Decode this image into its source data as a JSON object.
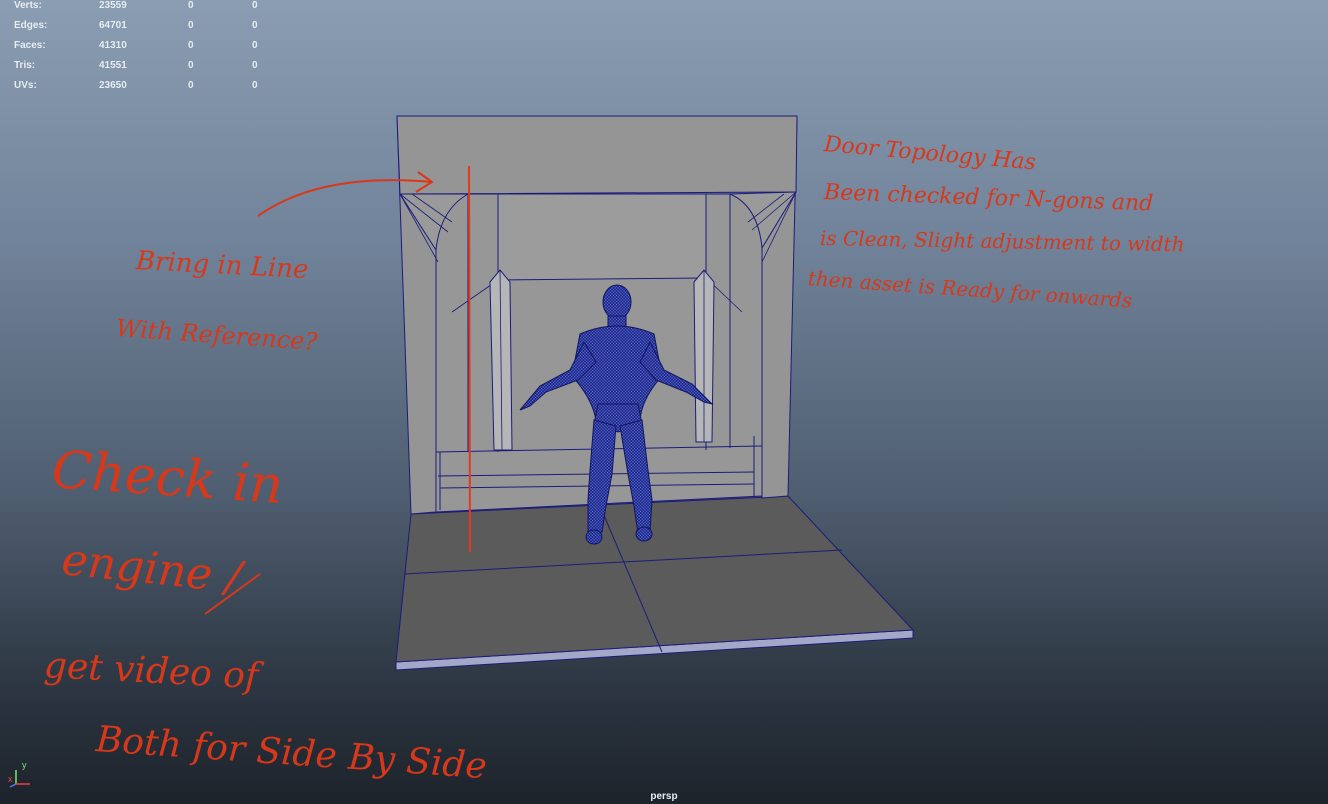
{
  "viewport": {
    "camera": "persp",
    "background_top": "#8a9db2",
    "background_bottom": "#1d232b"
  },
  "heads_up_display": {
    "poly_count": [
      {
        "label": "Verts:",
        "total": "23559",
        "selected": "0",
        "component": "0"
      },
      {
        "label": "Edges:",
        "total": "64701",
        "selected": "0",
        "component": "0"
      },
      {
        "label": "Faces:",
        "total": "41310",
        "selected": "0",
        "component": "0"
      },
      {
        "label": "Tris:",
        "total": "41551",
        "selected": "0",
        "component": "0"
      },
      {
        "label": "UVs:",
        "total": "23650",
        "selected": "0",
        "component": "0"
      }
    ]
  },
  "axis_gizmo": {
    "y_label": "y",
    "x_label": "x"
  },
  "scene": {
    "door_frame_color": "#959595",
    "floor_color": "#5b5b5b",
    "wireframe_color": "#1c1c7a",
    "character_mesh_color": "#202a8c"
  },
  "annotations": {
    "color": "#d8381a",
    "notes": [
      "Bring in Line",
      "With Reference?",
      "Door Topology Has",
      "Been checked for N-gons and",
      "is Clean, Slight adjustment to width",
      "then asset is Ready for onwards",
      "Check in",
      "engine /",
      "get video of",
      "Both for Side By Side"
    ]
  }
}
